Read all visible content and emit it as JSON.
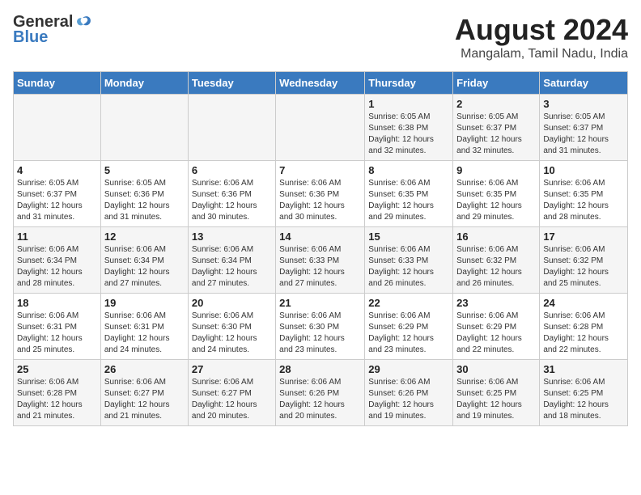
{
  "logo": {
    "general": "General",
    "blue": "Blue"
  },
  "header": {
    "month": "August 2024",
    "location": "Mangalam, Tamil Nadu, India"
  },
  "days_of_week": [
    "Sunday",
    "Monday",
    "Tuesday",
    "Wednesday",
    "Thursday",
    "Friday",
    "Saturday"
  ],
  "weeks": [
    [
      {
        "day": "",
        "info": ""
      },
      {
        "day": "",
        "info": ""
      },
      {
        "day": "",
        "info": ""
      },
      {
        "day": "",
        "info": ""
      },
      {
        "day": "1",
        "info": "Sunrise: 6:05 AM\nSunset: 6:38 PM\nDaylight: 12 hours\nand 32 minutes."
      },
      {
        "day": "2",
        "info": "Sunrise: 6:05 AM\nSunset: 6:37 PM\nDaylight: 12 hours\nand 32 minutes."
      },
      {
        "day": "3",
        "info": "Sunrise: 6:05 AM\nSunset: 6:37 PM\nDaylight: 12 hours\nand 31 minutes."
      }
    ],
    [
      {
        "day": "4",
        "info": "Sunrise: 6:05 AM\nSunset: 6:37 PM\nDaylight: 12 hours\nand 31 minutes."
      },
      {
        "day": "5",
        "info": "Sunrise: 6:05 AM\nSunset: 6:36 PM\nDaylight: 12 hours\nand 31 minutes."
      },
      {
        "day": "6",
        "info": "Sunrise: 6:06 AM\nSunset: 6:36 PM\nDaylight: 12 hours\nand 30 minutes."
      },
      {
        "day": "7",
        "info": "Sunrise: 6:06 AM\nSunset: 6:36 PM\nDaylight: 12 hours\nand 30 minutes."
      },
      {
        "day": "8",
        "info": "Sunrise: 6:06 AM\nSunset: 6:35 PM\nDaylight: 12 hours\nand 29 minutes."
      },
      {
        "day": "9",
        "info": "Sunrise: 6:06 AM\nSunset: 6:35 PM\nDaylight: 12 hours\nand 29 minutes."
      },
      {
        "day": "10",
        "info": "Sunrise: 6:06 AM\nSunset: 6:35 PM\nDaylight: 12 hours\nand 28 minutes."
      }
    ],
    [
      {
        "day": "11",
        "info": "Sunrise: 6:06 AM\nSunset: 6:34 PM\nDaylight: 12 hours\nand 28 minutes."
      },
      {
        "day": "12",
        "info": "Sunrise: 6:06 AM\nSunset: 6:34 PM\nDaylight: 12 hours\nand 27 minutes."
      },
      {
        "day": "13",
        "info": "Sunrise: 6:06 AM\nSunset: 6:34 PM\nDaylight: 12 hours\nand 27 minutes."
      },
      {
        "day": "14",
        "info": "Sunrise: 6:06 AM\nSunset: 6:33 PM\nDaylight: 12 hours\nand 27 minutes."
      },
      {
        "day": "15",
        "info": "Sunrise: 6:06 AM\nSunset: 6:33 PM\nDaylight: 12 hours\nand 26 minutes."
      },
      {
        "day": "16",
        "info": "Sunrise: 6:06 AM\nSunset: 6:32 PM\nDaylight: 12 hours\nand 26 minutes."
      },
      {
        "day": "17",
        "info": "Sunrise: 6:06 AM\nSunset: 6:32 PM\nDaylight: 12 hours\nand 25 minutes."
      }
    ],
    [
      {
        "day": "18",
        "info": "Sunrise: 6:06 AM\nSunset: 6:31 PM\nDaylight: 12 hours\nand 25 minutes."
      },
      {
        "day": "19",
        "info": "Sunrise: 6:06 AM\nSunset: 6:31 PM\nDaylight: 12 hours\nand 24 minutes."
      },
      {
        "day": "20",
        "info": "Sunrise: 6:06 AM\nSunset: 6:30 PM\nDaylight: 12 hours\nand 24 minutes."
      },
      {
        "day": "21",
        "info": "Sunrise: 6:06 AM\nSunset: 6:30 PM\nDaylight: 12 hours\nand 23 minutes."
      },
      {
        "day": "22",
        "info": "Sunrise: 6:06 AM\nSunset: 6:29 PM\nDaylight: 12 hours\nand 23 minutes."
      },
      {
        "day": "23",
        "info": "Sunrise: 6:06 AM\nSunset: 6:29 PM\nDaylight: 12 hours\nand 22 minutes."
      },
      {
        "day": "24",
        "info": "Sunrise: 6:06 AM\nSunset: 6:28 PM\nDaylight: 12 hours\nand 22 minutes."
      }
    ],
    [
      {
        "day": "25",
        "info": "Sunrise: 6:06 AM\nSunset: 6:28 PM\nDaylight: 12 hours\nand 21 minutes."
      },
      {
        "day": "26",
        "info": "Sunrise: 6:06 AM\nSunset: 6:27 PM\nDaylight: 12 hours\nand 21 minutes."
      },
      {
        "day": "27",
        "info": "Sunrise: 6:06 AM\nSunset: 6:27 PM\nDaylight: 12 hours\nand 20 minutes."
      },
      {
        "day": "28",
        "info": "Sunrise: 6:06 AM\nSunset: 6:26 PM\nDaylight: 12 hours\nand 20 minutes."
      },
      {
        "day": "29",
        "info": "Sunrise: 6:06 AM\nSunset: 6:26 PM\nDaylight: 12 hours\nand 19 minutes."
      },
      {
        "day": "30",
        "info": "Sunrise: 6:06 AM\nSunset: 6:25 PM\nDaylight: 12 hours\nand 19 minutes."
      },
      {
        "day": "31",
        "info": "Sunrise: 6:06 AM\nSunset: 6:25 PM\nDaylight: 12 hours\nand 18 minutes."
      }
    ]
  ]
}
